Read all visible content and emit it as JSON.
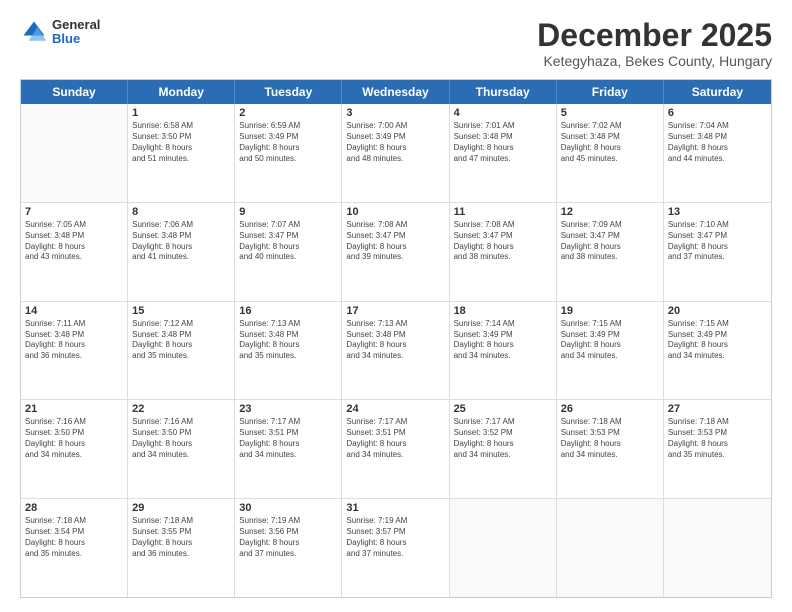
{
  "logo": {
    "general": "General",
    "blue": "Blue"
  },
  "header": {
    "title": "December 2025",
    "subtitle": "Ketegyhaza, Bekes County, Hungary"
  },
  "weekdays": [
    "Sunday",
    "Monday",
    "Tuesday",
    "Wednesday",
    "Thursday",
    "Friday",
    "Saturday"
  ],
  "weeks": [
    [
      {
        "day": "",
        "sunrise": "",
        "sunset": "",
        "daylight": ""
      },
      {
        "day": "1",
        "sunrise": "Sunrise: 6:58 AM",
        "sunset": "Sunset: 3:50 PM",
        "daylight": "Daylight: 8 hours and 51 minutes."
      },
      {
        "day": "2",
        "sunrise": "Sunrise: 6:59 AM",
        "sunset": "Sunset: 3:49 PM",
        "daylight": "Daylight: 8 hours and 50 minutes."
      },
      {
        "day": "3",
        "sunrise": "Sunrise: 7:00 AM",
        "sunset": "Sunset: 3:49 PM",
        "daylight": "Daylight: 8 hours and 48 minutes."
      },
      {
        "day": "4",
        "sunrise": "Sunrise: 7:01 AM",
        "sunset": "Sunset: 3:48 PM",
        "daylight": "Daylight: 8 hours and 47 minutes."
      },
      {
        "day": "5",
        "sunrise": "Sunrise: 7:02 AM",
        "sunset": "Sunset: 3:48 PM",
        "daylight": "Daylight: 8 hours and 45 minutes."
      },
      {
        "day": "6",
        "sunrise": "Sunrise: 7:04 AM",
        "sunset": "Sunset: 3:48 PM",
        "daylight": "Daylight: 8 hours and 44 minutes."
      }
    ],
    [
      {
        "day": "7",
        "sunrise": "Sunrise: 7:05 AM",
        "sunset": "Sunset: 3:48 PM",
        "daylight": "Daylight: 8 hours and 43 minutes."
      },
      {
        "day": "8",
        "sunrise": "Sunrise: 7:06 AM",
        "sunset": "Sunset: 3:48 PM",
        "daylight": "Daylight: 8 hours and 41 minutes."
      },
      {
        "day": "9",
        "sunrise": "Sunrise: 7:07 AM",
        "sunset": "Sunset: 3:47 PM",
        "daylight": "Daylight: 8 hours and 40 minutes."
      },
      {
        "day": "10",
        "sunrise": "Sunrise: 7:08 AM",
        "sunset": "Sunset: 3:47 PM",
        "daylight": "Daylight: 8 hours and 39 minutes."
      },
      {
        "day": "11",
        "sunrise": "Sunrise: 7:08 AM",
        "sunset": "Sunset: 3:47 PM",
        "daylight": "Daylight: 8 hours and 38 minutes."
      },
      {
        "day": "12",
        "sunrise": "Sunrise: 7:09 AM",
        "sunset": "Sunset: 3:47 PM",
        "daylight": "Daylight: 8 hours and 38 minutes."
      },
      {
        "day": "13",
        "sunrise": "Sunrise: 7:10 AM",
        "sunset": "Sunset: 3:47 PM",
        "daylight": "Daylight: 8 hours and 37 minutes."
      }
    ],
    [
      {
        "day": "14",
        "sunrise": "Sunrise: 7:11 AM",
        "sunset": "Sunset: 3:48 PM",
        "daylight": "Daylight: 8 hours and 36 minutes."
      },
      {
        "day": "15",
        "sunrise": "Sunrise: 7:12 AM",
        "sunset": "Sunset: 3:48 PM",
        "daylight": "Daylight: 8 hours and 35 minutes."
      },
      {
        "day": "16",
        "sunrise": "Sunrise: 7:13 AM",
        "sunset": "Sunset: 3:48 PM",
        "daylight": "Daylight: 8 hours and 35 minutes."
      },
      {
        "day": "17",
        "sunrise": "Sunrise: 7:13 AM",
        "sunset": "Sunset: 3:48 PM",
        "daylight": "Daylight: 8 hours and 34 minutes."
      },
      {
        "day": "18",
        "sunrise": "Sunrise: 7:14 AM",
        "sunset": "Sunset: 3:49 PM",
        "daylight": "Daylight: 8 hours and 34 minutes."
      },
      {
        "day": "19",
        "sunrise": "Sunrise: 7:15 AM",
        "sunset": "Sunset: 3:49 PM",
        "daylight": "Daylight: 8 hours and 34 minutes."
      },
      {
        "day": "20",
        "sunrise": "Sunrise: 7:15 AM",
        "sunset": "Sunset: 3:49 PM",
        "daylight": "Daylight: 8 hours and 34 minutes."
      }
    ],
    [
      {
        "day": "21",
        "sunrise": "Sunrise: 7:16 AM",
        "sunset": "Sunset: 3:50 PM",
        "daylight": "Daylight: 8 hours and 34 minutes."
      },
      {
        "day": "22",
        "sunrise": "Sunrise: 7:16 AM",
        "sunset": "Sunset: 3:50 PM",
        "daylight": "Daylight: 8 hours and 34 minutes."
      },
      {
        "day": "23",
        "sunrise": "Sunrise: 7:17 AM",
        "sunset": "Sunset: 3:51 PM",
        "daylight": "Daylight: 8 hours and 34 minutes."
      },
      {
        "day": "24",
        "sunrise": "Sunrise: 7:17 AM",
        "sunset": "Sunset: 3:51 PM",
        "daylight": "Daylight: 8 hours and 34 minutes."
      },
      {
        "day": "25",
        "sunrise": "Sunrise: 7:17 AM",
        "sunset": "Sunset: 3:52 PM",
        "daylight": "Daylight: 8 hours and 34 minutes."
      },
      {
        "day": "26",
        "sunrise": "Sunrise: 7:18 AM",
        "sunset": "Sunset: 3:53 PM",
        "daylight": "Daylight: 8 hours and 34 minutes."
      },
      {
        "day": "27",
        "sunrise": "Sunrise: 7:18 AM",
        "sunset": "Sunset: 3:53 PM",
        "daylight": "Daylight: 8 hours and 35 minutes."
      }
    ],
    [
      {
        "day": "28",
        "sunrise": "Sunrise: 7:18 AM",
        "sunset": "Sunset: 3:54 PM",
        "daylight": "Daylight: 8 hours and 35 minutes."
      },
      {
        "day": "29",
        "sunrise": "Sunrise: 7:18 AM",
        "sunset": "Sunset: 3:55 PM",
        "daylight": "Daylight: 8 hours and 36 minutes."
      },
      {
        "day": "30",
        "sunrise": "Sunrise: 7:19 AM",
        "sunset": "Sunset: 3:56 PM",
        "daylight": "Daylight: 8 hours and 37 minutes."
      },
      {
        "day": "31",
        "sunrise": "Sunrise: 7:19 AM",
        "sunset": "Sunset: 3:57 PM",
        "daylight": "Daylight: 8 hours and 37 minutes."
      },
      {
        "day": "",
        "sunrise": "",
        "sunset": "",
        "daylight": ""
      },
      {
        "day": "",
        "sunrise": "",
        "sunset": "",
        "daylight": ""
      },
      {
        "day": "",
        "sunrise": "",
        "sunset": "",
        "daylight": ""
      }
    ]
  ]
}
